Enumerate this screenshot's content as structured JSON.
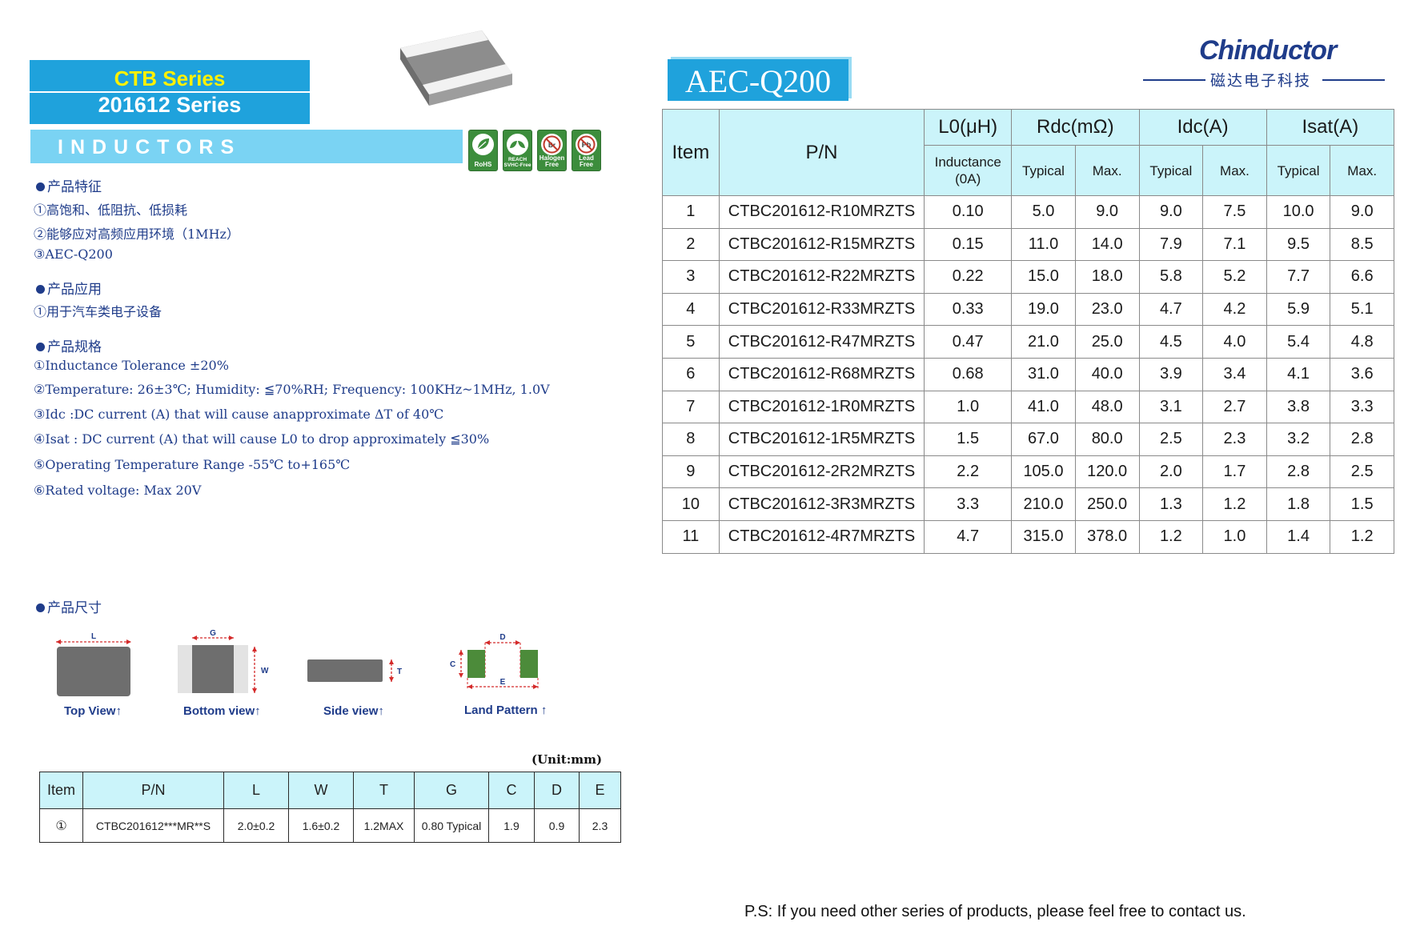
{
  "header": {
    "series_line1": "CTB Series",
    "series_line2": "201612 Series",
    "category": "INDUCTORS",
    "badges": [
      {
        "label": "RoHS",
        "icon": "leaf-icon"
      },
      {
        "label": "REACH SVHC-Free",
        "icon": "leaves-icon"
      },
      {
        "label": "Halogen Free",
        "icon": "no-halogen-icon"
      },
      {
        "label": "Lead Free",
        "icon": "no-lead-icon"
      }
    ]
  },
  "features": {
    "title": "产品特征",
    "items": [
      "①高饱和、低阻抗、低损耗",
      "②能够应对高频应用环境（1MHz）",
      "③AEC-Q200"
    ]
  },
  "applications": {
    "title": "产品应用",
    "items": [
      "①用于汽车类电子设备"
    ]
  },
  "specs": {
    "title": "产品规格",
    "items": [
      "①Inductance Tolerance ±20%",
      "②Temperature: 26±3℃; Humidity: ≦70%RH; Frequency: 100KHz~1MHz, 1.0V",
      "③Idc :DC current (A) that will cause anapproximate ΔT of 40℃",
      "④Isat : DC current (A) that will cause L0 to drop approximately ≦30%",
      "⑤Operating Temperature Range -55℃ to+165℃",
      "⑥Rated voltage: Max 20V"
    ]
  },
  "dimensions": {
    "title": "产品尺寸",
    "views": {
      "top": {
        "caption": "Top View↑",
        "dim_l": "L"
      },
      "bottom": {
        "caption": "Bottom view↑",
        "dim_g": "G",
        "dim_w": "W"
      },
      "side": {
        "caption": "Side view↑",
        "dim_t": "T"
      },
      "land": {
        "caption": "Land Pattern ↑",
        "dim_d": "D",
        "dim_c": "C",
        "dim_e": "E"
      }
    },
    "unit": "(Unit:mm)",
    "columns": [
      "Item",
      "P/N",
      "L",
      "W",
      "T",
      "G",
      "C",
      "D",
      "E"
    ],
    "rows": [
      [
        "①",
        "CTBC201612***MR**S",
        "2.0±0.2",
        "1.6±0.2",
        "1.2MAX",
        "0.80 Typical",
        "1.9",
        "0.9",
        "2.3"
      ]
    ]
  },
  "right_header": {
    "standard": "AEC-Q200",
    "brand": "Chinductor",
    "brand_cn": "磁达电子科技"
  },
  "spec_table": {
    "group_headers": {
      "item": "Item",
      "pn": "P/N",
      "l0": "L0(μH)",
      "rdc": "Rdc(mΩ)",
      "idc": "Idc(A)",
      "isat": "Isat(A)"
    },
    "sub_headers": {
      "l0": "Inductance (0A)",
      "rdc_typ": "Typical",
      "rdc_max": "Max.",
      "idc_typ": "Typical",
      "idc_max": "Max.",
      "isat_typ": "Typical",
      "isat_max": "Max."
    },
    "rows": [
      [
        "1",
        "CTBC201612-R10MRZTS",
        "0.10",
        "5.0",
        "9.0",
        "9.0",
        "7.5",
        "10.0",
        "9.0"
      ],
      [
        "2",
        "CTBC201612-R15MRZTS",
        "0.15",
        "11.0",
        "14.0",
        "7.9",
        "7.1",
        "9.5",
        "8.5"
      ],
      [
        "3",
        "CTBC201612-R22MRZTS",
        "0.22",
        "15.0",
        "18.0",
        "5.8",
        "5.2",
        "7.7",
        "6.6"
      ],
      [
        "4",
        "CTBC201612-R33MRZTS",
        "0.33",
        "19.0",
        "23.0",
        "4.7",
        "4.2",
        "5.9",
        "5.1"
      ],
      [
        "5",
        "CTBC201612-R47MRZTS",
        "0.47",
        "21.0",
        "25.0",
        "4.5",
        "4.0",
        "5.4",
        "4.8"
      ],
      [
        "6",
        "CTBC201612-R68MRZTS",
        "0.68",
        "31.0",
        "40.0",
        "3.9",
        "3.4",
        "4.1",
        "3.6"
      ],
      [
        "7",
        "CTBC201612-1R0MRZTS",
        "1.0",
        "41.0",
        "48.0",
        "3.1",
        "2.7",
        "3.8",
        "3.3"
      ],
      [
        "8",
        "CTBC201612-1R5MRZTS",
        "1.5",
        "67.0",
        "80.0",
        "2.5",
        "2.3",
        "3.2",
        "2.8"
      ],
      [
        "9",
        "CTBC201612-2R2MRZTS",
        "2.2",
        "105.0",
        "120.0",
        "2.0",
        "1.7",
        "2.8",
        "2.5"
      ],
      [
        "10",
        "CTBC201612-3R3MRZTS",
        "3.3",
        "210.0",
        "250.0",
        "1.3",
        "1.2",
        "1.8",
        "1.5"
      ],
      [
        "11",
        "CTBC201612-4R7MRZTS",
        "4.7",
        "315.0",
        "378.0",
        "1.2",
        "1.0",
        "1.4",
        "1.2"
      ]
    ]
  },
  "footer": {
    "note": "P.S: If you need other series of products, please feel free to contact us."
  }
}
